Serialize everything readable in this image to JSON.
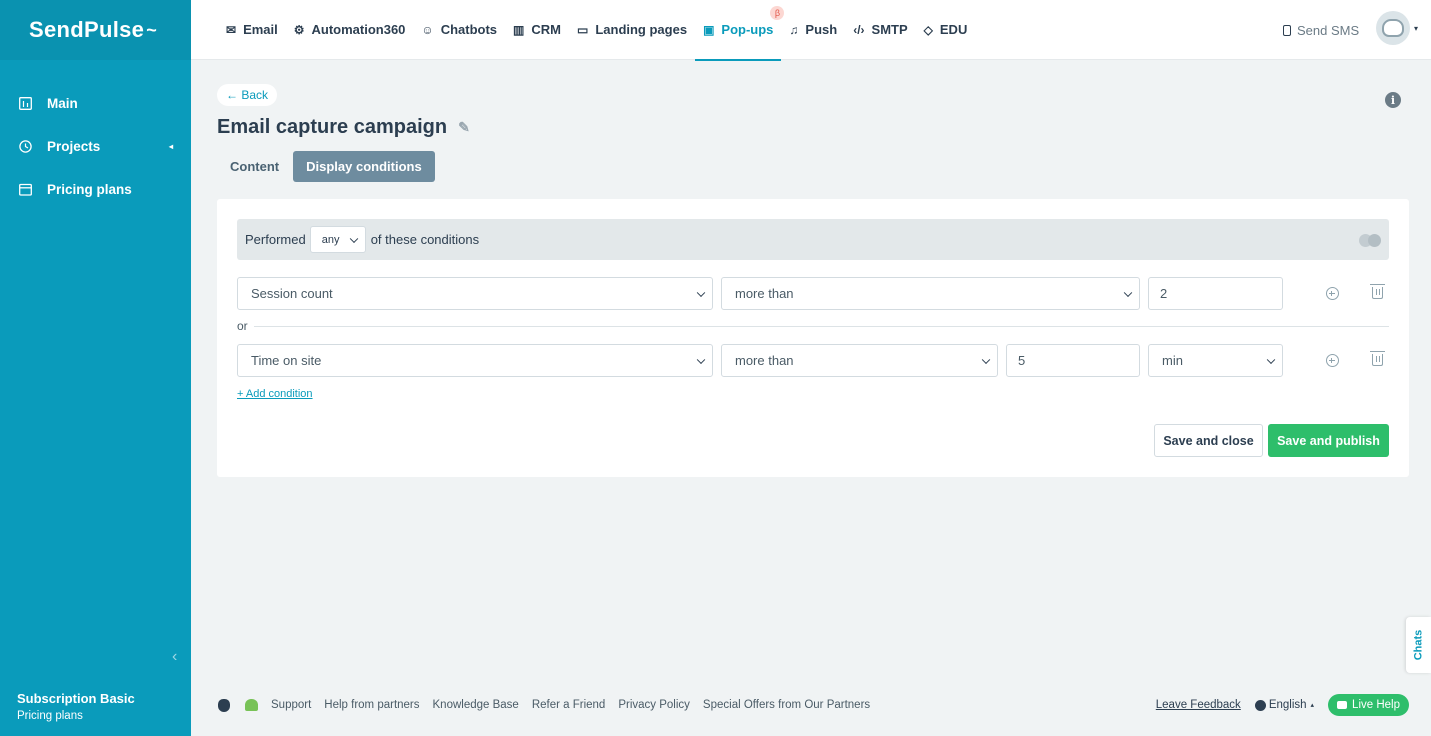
{
  "app": {
    "logo_text": "SendPulse",
    "logo_mark": "~",
    "brand_color": "#0a9bbb",
    "success_color": "#2ebe6b"
  },
  "sidebar": {
    "items": [
      {
        "label": "Main",
        "icon": "dashboard-icon"
      },
      {
        "label": "Projects",
        "icon": "projects-icon",
        "caret": "◂"
      },
      {
        "label": "Pricing plans",
        "icon": "pricing-icon"
      }
    ],
    "collapse_glyph": "‹",
    "subscription_title": "Subscription Basic",
    "subscription_link": "Pricing plans"
  },
  "topnav": {
    "items": [
      {
        "label": "Email",
        "icon": "envelope-icon",
        "glyph": "✉"
      },
      {
        "label": "Automation360",
        "icon": "automation-icon",
        "glyph": "⚙"
      },
      {
        "label": "Chatbots",
        "icon": "chatbot-icon",
        "glyph": "☺"
      },
      {
        "label": "CRM",
        "icon": "crm-icon",
        "glyph": "▥"
      },
      {
        "label": "Landing pages",
        "icon": "landing-icon",
        "glyph": "▭"
      },
      {
        "label": "Pop-ups",
        "icon": "popups-icon",
        "glyph": "▣",
        "active": true,
        "badge": "β"
      },
      {
        "label": "Push",
        "icon": "bell-icon",
        "glyph": "♫"
      },
      {
        "label": "SMTP",
        "icon": "code-icon",
        "glyph": "‹/›"
      },
      {
        "label": "EDU",
        "icon": "graduation-icon",
        "glyph": "◇"
      }
    ],
    "send_sms": "Send SMS",
    "avatar_caret": "▾"
  },
  "page": {
    "back_label": "← Back",
    "info_glyph": "i",
    "title": "Email capture campaign",
    "edit_glyph": "✎",
    "tabs": [
      {
        "label": "Content",
        "active": false
      },
      {
        "label": "Display conditions",
        "active": true
      }
    ]
  },
  "conditions": {
    "performed_label": "Performed",
    "match_mode": "any",
    "suffix_label": "of these conditions",
    "or_label": "or",
    "rows": [
      {
        "field": "Session count",
        "operator": "more than",
        "value": "2",
        "unit": ""
      },
      {
        "field": "Time on site",
        "operator": "more than",
        "value": "5",
        "unit": "min"
      }
    ],
    "add_label": "+ Add condition"
  },
  "actions": {
    "save_close": "Save and close",
    "save_publish": "Save and publish"
  },
  "footer": {
    "links": [
      "Support",
      "Help from partners",
      "Knowledge Base",
      "Refer a Friend",
      "Privacy Policy",
      "Special Offers from Our Partners"
    ],
    "leave_feedback": "Leave Feedback",
    "language": "English",
    "language_caret": "▴",
    "live_help": "Live Help"
  },
  "chats_tab": "Chats"
}
